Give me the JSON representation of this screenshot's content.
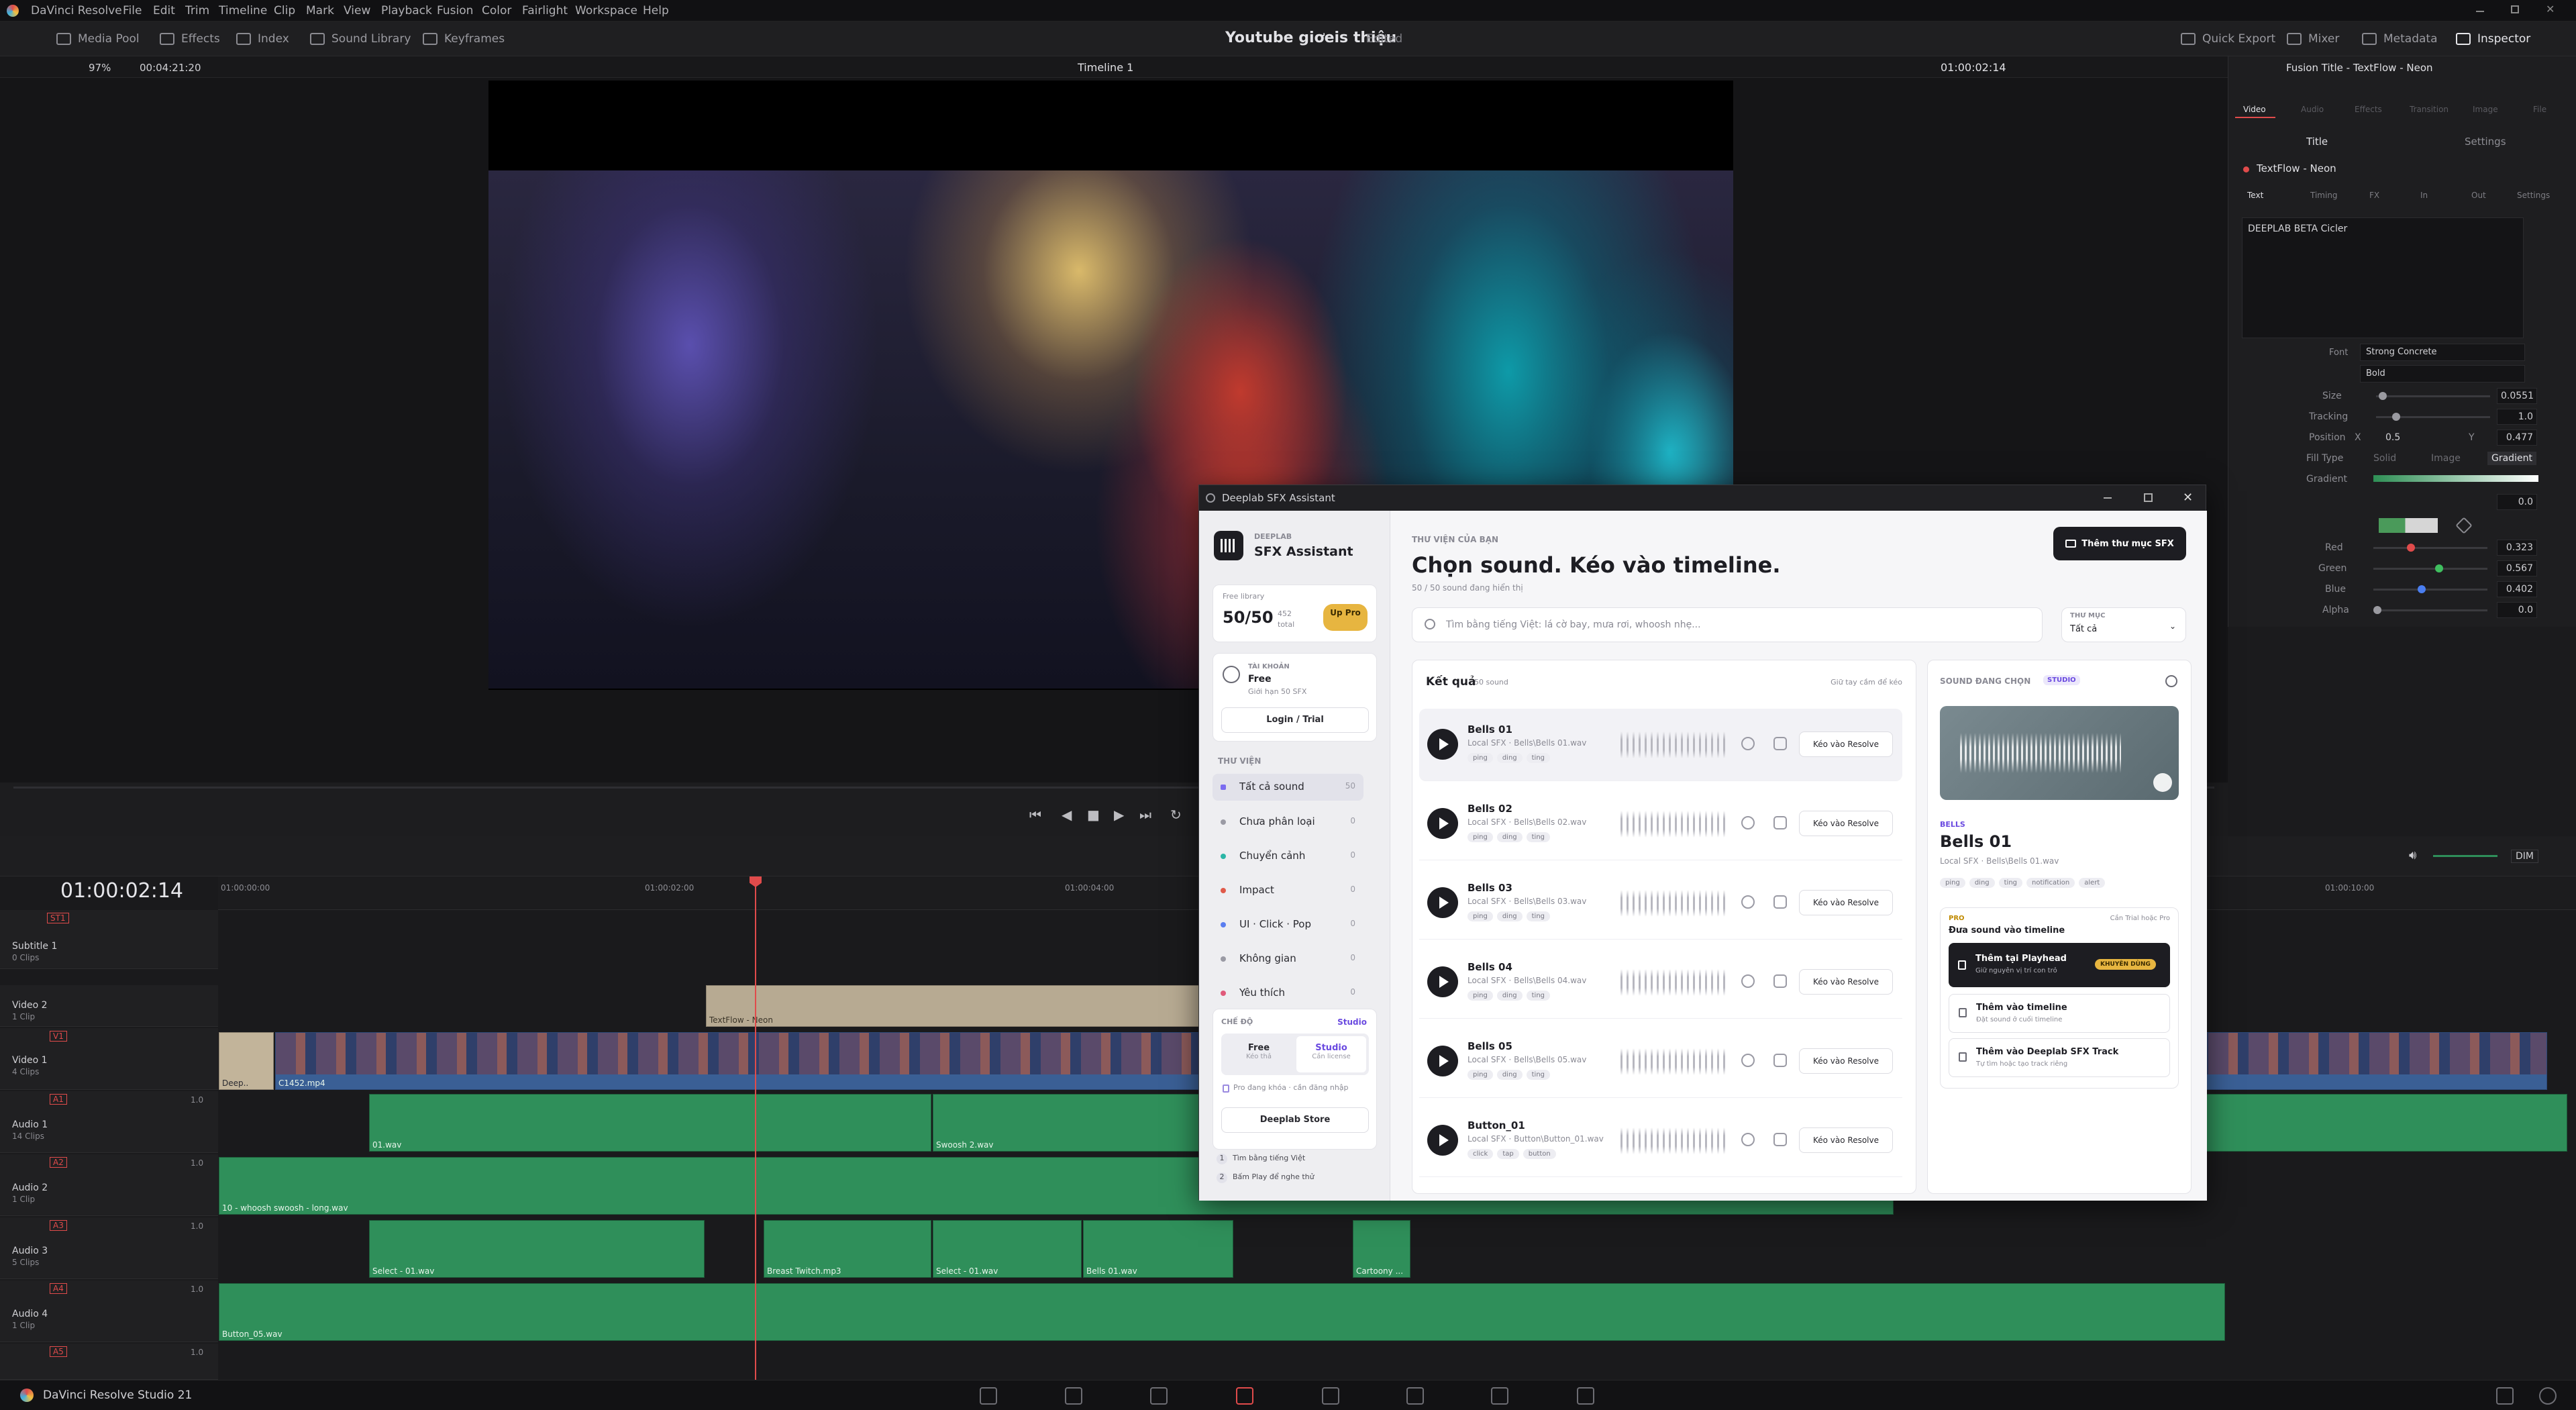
{
  "menu": {
    "app": "DaVinci Resolve",
    "items": [
      "File",
      "Edit",
      "Trim",
      "Timeline",
      "Clip",
      "Mark",
      "View",
      "Playback",
      "Fusion",
      "Color",
      "Fairlight",
      "Workspace",
      "Help"
    ]
  },
  "toolbar": {
    "media_pool": "Media Pool",
    "effects": "Effects",
    "index": "Index",
    "sound_library": "Sound Library",
    "keyframes": "Keyframes",
    "project_title": "Youtube giơeis thiệu",
    "edited": "Edited",
    "quick_export": "Quick Export",
    "mixer": "Mixer",
    "metadata": "Metadata",
    "inspector": "Inspector"
  },
  "viewer": {
    "zoom": "97%",
    "timecode_left": "00:04:21:20",
    "timeline_name": "Timeline 1",
    "timecode_right": "01:00:02:14"
  },
  "inspector": {
    "title": "Fusion Title - TextFlow - Neon",
    "tabs": [
      "Video",
      "Audio",
      "Effects",
      "Transition",
      "Image",
      "File"
    ],
    "subtabs": [
      "Title",
      "Settings"
    ],
    "node": "TextFlow - Neon",
    "node_tabs": [
      "Text",
      "Timing",
      "FX",
      "In",
      "Out",
      "Settings"
    ],
    "text_value": "DEEPLAB BETA Cicler",
    "font_label": "Font",
    "font": "Strong Concrete",
    "style": "Bold",
    "rows": [
      {
        "label": "Size",
        "value": "0.0551"
      },
      {
        "label": "Tracking",
        "value": "1.0"
      },
      {
        "label": "Position",
        "x_label": "X",
        "x": "0.5",
        "y_label": "Y",
        "y": "0.477"
      },
      {
        "label": "Fill Type",
        "options": [
          "Solid",
          "Image",
          "Gradient"
        ]
      },
      {
        "label": "Gradient",
        "value": "0.0"
      },
      {
        "label": "Red",
        "value": "0.323"
      },
      {
        "label": "Green",
        "value": "0.567"
      },
      {
        "label": "Blue",
        "value": "0.402"
      },
      {
        "label": "Alpha",
        "value": "0.0"
      }
    ]
  },
  "timeline": {
    "timecode": "01:00:02:14",
    "ruler": [
      "01:00:00:00",
      "01:00:02:00",
      "01:00:04:00",
      "01:00:10:00"
    ],
    "dim": "DIM",
    "tracks": [
      {
        "id": "ST1",
        "name": "Subtitle 1",
        "clips": "0 Clips"
      },
      {
        "id": "",
        "name": "Video 2",
        "clips": "1 Clip"
      },
      {
        "id": "V1",
        "name": "Video 1",
        "clips": "4 Clips"
      },
      {
        "id": "A1",
        "name": "Audio 1",
        "clips": "14 Clips",
        "level": "1.0"
      },
      {
        "id": "A2",
        "name": "Audio 2",
        "clips": "1 Clip",
        "level": "1.0"
      },
      {
        "id": "A3",
        "name": "Audio 3",
        "clips": "5 Clips",
        "level": "1.0"
      },
      {
        "id": "A4",
        "name": "Audio 4",
        "clips": "1 Clip",
        "level": "1.0"
      },
      {
        "id": "A5",
        "name": "Audio 5",
        "clips": "",
        "level": "1.0"
      }
    ],
    "clips": {
      "title": "TextFlow - Neon",
      "video_a": "Deep..",
      "video_b": "C1452.mp4",
      "a1_1": "01.wav",
      "a1_2": "Swoosh 2.wav",
      "a2_1": "10 - whoosh swoosh - long.wav",
      "a3_1": "Select - 01.wav",
      "a3_2": "Breast Twitch.mp3",
      "a3_3": "Select - 01.wav",
      "a3_4": "Bells 01.wav",
      "a3_5": "Cartoony ...",
      "a4_1": "Button_05.wav"
    }
  },
  "status": {
    "app": "DaVinci Resolve Studio 21"
  },
  "deeplab": {
    "window_title": "Deeplab SFX Assistant",
    "brand_small": "DEEPLAB",
    "brand": "SFX Assistant",
    "lib_label": "Free library",
    "lib_count": "50/50",
    "lib_total_num": "452",
    "lib_total": "total",
    "up_pro": "Up Pro",
    "account_label": "TÀI KHOẢN",
    "account_plan": "Free",
    "account_limit": "Giới hạn 50 SFX",
    "login": "Login / Trial",
    "library_label": "THƯ VIỆN",
    "categories": [
      {
        "name": "Tất cả sound",
        "count": "50",
        "color": "#7b6cf0"
      },
      {
        "name": "Chưa phân loại",
        "count": "0",
        "color": "#9a9aa4"
      },
      {
        "name": "Chuyển cảnh",
        "count": "0",
        "color": "#2bb6a6"
      },
      {
        "name": "Impact",
        "count": "0",
        "color": "#e05a4a"
      },
      {
        "name": "UI · Click · Pop",
        "count": "0",
        "color": "#5a7ef0"
      },
      {
        "name": "Không gian",
        "count": "0",
        "color": "#9a9aa4"
      },
      {
        "name": "Yêu thích",
        "count": "0",
        "color": "#e05a7a"
      }
    ],
    "mode_label": "CHẾ ĐỘ",
    "mode_value": "Studio",
    "mode_free": "Free",
    "mode_free_sub": "Kéo thả",
    "mode_studio": "Studio",
    "mode_studio_sub": "Cần license",
    "pro_note": "Pro đang khóa · cần đăng nhập",
    "store": "Deeplab Store",
    "tips": [
      {
        "n": "1",
        "t": "Tìm bằng tiếng Việt"
      },
      {
        "n": "2",
        "t": "Bấm Play để nghe thử"
      }
    ],
    "header_small": "THƯ VIỆN CỦA BẠN",
    "header": "Chọn sound. Kéo vào timeline.",
    "header_sub": "50 / 50 sound đang hiển thị",
    "add_folder": "Thêm thư mục SFX",
    "search_placeholder": "Tìm bằng tiếng Việt: lá cờ bay, mưa rơi, whoosh nhẹ...",
    "folder_label": "THƯ MỤC",
    "folder_value": "Tất cả",
    "results_label": "Kết quả",
    "results_count": "50 sound",
    "results_hint": "Giữ tay cầm để kéo",
    "sounds": [
      {
        "title": "Bells 01",
        "path": "Local SFX · Bells\\Bells 01.wav",
        "tags": [
          "ping",
          "ding",
          "ting"
        ]
      },
      {
        "title": "Bells 02",
        "path": "Local SFX · Bells\\Bells 02.wav",
        "tags": [
          "ping",
          "ding",
          "ting"
        ]
      },
      {
        "title": "Bells 03",
        "path": "Local SFX · Bells\\Bells 03.wav",
        "tags": [
          "ping",
          "ding",
          "ting"
        ]
      },
      {
        "title": "Bells 04",
        "path": "Local SFX · Bells\\Bells 04.wav",
        "tags": [
          "ping",
          "ding",
          "ting"
        ]
      },
      {
        "title": "Bells 05",
        "path": "Local SFX · Bells\\Bells 05.wav",
        "tags": [
          "ping",
          "ding",
          "ting"
        ]
      },
      {
        "title": "Button_01",
        "path": "Local SFX · Button\\Button_01.wav",
        "tags": [
          "click",
          "tap",
          "button"
        ]
      }
    ],
    "kbtn": "Kéo vào Resolve",
    "sel_label": "SOUND ĐANG CHỌN",
    "sel_badge": "STUDIO",
    "sel_cat": "BELLS",
    "sel_title": "Bells 01",
    "sel_path": "Local SFX · Bells\\Bells 01.wav",
    "sel_tags": [
      "ping",
      "ding",
      "ting",
      "notification",
      "alert"
    ],
    "pro_small": "PRO",
    "pro_hint": "Cần Trial hoặc Pro",
    "pro_title": "Đưa sound vào timeline",
    "opt1": "Thêm tại Playhead",
    "opt1_sub": "Giữ nguyên vị trí con trỏ",
    "opt1_badge": "KHUYÊN DÙNG",
    "opt2": "Thêm vào timeline",
    "opt2_sub": "Đặt sound ở cuối timeline",
    "opt3": "Thêm vào Deeplab SFX Track",
    "opt3_sub": "Tự tìm hoặc tạo track riêng"
  }
}
